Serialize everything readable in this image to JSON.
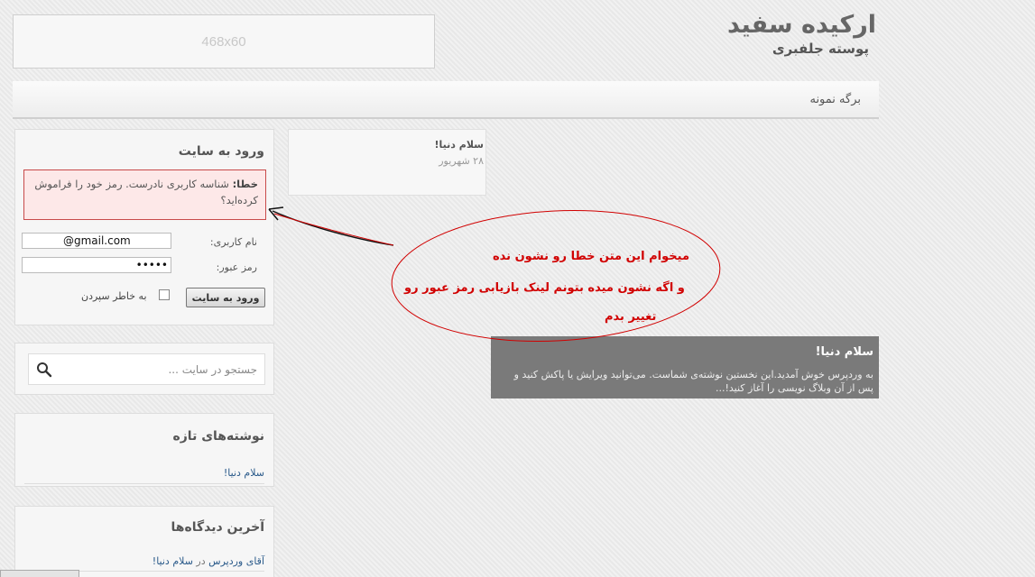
{
  "header": {
    "ad_label": "468x60",
    "logo_title": "ارکیده سفید",
    "logo_subtitle": "پوسته جلفبری"
  },
  "nav": {
    "items": [
      "برگه نمونه"
    ]
  },
  "login": {
    "title": "ورود به سایت",
    "error_prefix": "خطا:",
    "error_message": "شناسه کاربری نادرست.",
    "error_link": "رمز خود را فراموش کرده‌اید؟",
    "username_label": "نام کاربری:",
    "username_value": "           @gmail.com",
    "password_label": "رمز عبور:",
    "password_value": "•••••",
    "remember_label": "به خاطر سپردن",
    "submit_label": "ورود به سایت"
  },
  "search": {
    "placeholder": "جستجو در سایت ..."
  },
  "recent_posts": {
    "title": "نوشته‌های تازه",
    "items": [
      "سلام دنیا!"
    ]
  },
  "recent_comments": {
    "title": "آخرین دیدگاه‌ها",
    "author": "آقای وردپرس",
    "connector": "در",
    "post": "سلام دنیا!"
  },
  "post_card": {
    "title": "سلام دنیا!",
    "date": "۲۸ شهریور"
  },
  "featured": {
    "title": "سلام دنیا!",
    "excerpt": "به وردپرس خوش آمدید.این نخستین نوشته‌ی شماست. می‌توانید ویرایش یا پاکش کنید و پس از آن وبلاگ نویسی را آغاز کنید!..."
  },
  "annotation": {
    "line1": "میخوام این متن خطا رو نشون نده",
    "line2": "و اگه نشون میده بتونم لینک بازیابی رمز عبور رو",
    "line3": "تغییر بدم",
    "color": "#d10000"
  }
}
